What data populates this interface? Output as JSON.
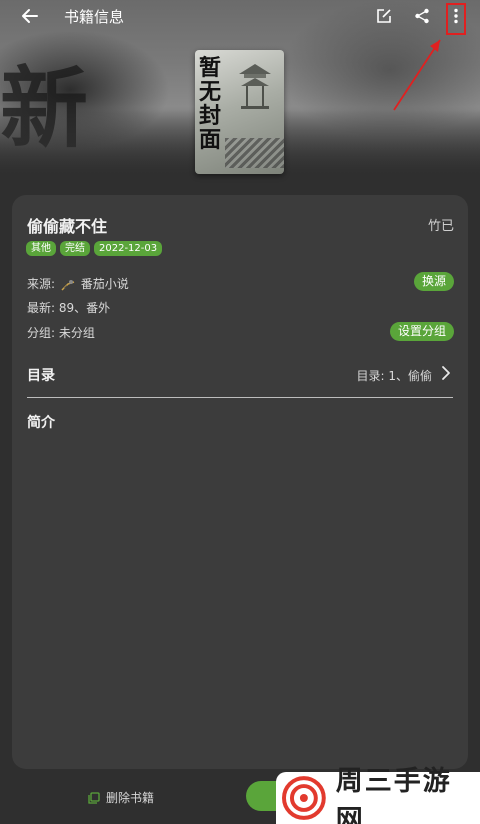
{
  "header": {
    "title": "书籍信息",
    "bg_glyph": "新"
  },
  "cover": {
    "text": "暂无封面"
  },
  "book": {
    "name": "偷偷藏不住",
    "author": "竹已",
    "tags": [
      "其他",
      "完结",
      "2022-12-03"
    ],
    "source_label": "来源:",
    "source_name": "番茄小说",
    "change_source_label": "换源",
    "latest": "最新: 89、番外",
    "group": "分组: 未分组",
    "set_group_label": "设置分组"
  },
  "toc": {
    "label": "目录",
    "value": "目录: 1、偷偷"
  },
  "intro": {
    "label": "简介"
  },
  "bottom": {
    "delete_label": "删除书籍"
  },
  "watermark": {
    "text": "周三手游网"
  },
  "colors": {
    "accent": "#5aa53a",
    "background": "#2f2f2f",
    "card": "#3c3c3c",
    "annotation": "#e02020"
  },
  "icons": {
    "back": "arrow-left-icon",
    "edit": "edit-icon",
    "share": "share-icon",
    "more": "more-vertical-icon",
    "chevron": "chevron-right-icon",
    "delete": "delete-icon"
  }
}
